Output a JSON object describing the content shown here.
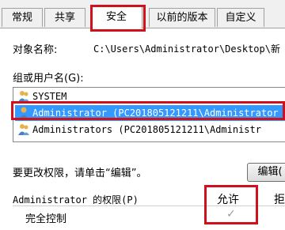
{
  "tabs": [
    {
      "label": "常规"
    },
    {
      "label": "共享"
    },
    {
      "label": "安全"
    },
    {
      "label": "以前的版本"
    },
    {
      "label": "自定义"
    }
  ],
  "object_name": {
    "label": "对象名称:",
    "value": "C:\\Users\\Administrator\\Desktop\\新"
  },
  "group_list": {
    "label": "组或用户名(G):",
    "items": [
      {
        "name": "SYSTEM",
        "icon": "users-icon"
      },
      {
        "name": "Administrator (PC201805121211\\Administrator",
        "icon": "user-icon",
        "selected": true
      },
      {
        "name": "Administrators (PC201805121211\\Administr",
        "icon": "users-icon"
      }
    ]
  },
  "change_hint": "要更改权限，请单击“编辑”。",
  "edit_button": "编辑(",
  "permissions": {
    "label": "Administrator 的权限(P)",
    "allow_header": "允许",
    "deny_header": "拒",
    "first_row": "完全控制"
  },
  "colors": {
    "selection": "#3399ff",
    "highlight_border": "#d0101c"
  }
}
